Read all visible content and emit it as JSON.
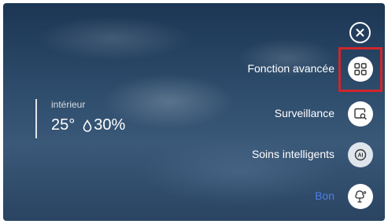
{
  "indoor": {
    "label": "intérieur",
    "temperature": "25°",
    "humidity": "30%"
  },
  "menu": {
    "items": [
      {
        "label": "Fonction avancée",
        "icon": "grid-icon",
        "highlighted": true
      },
      {
        "label": "Surveillance",
        "icon": "monitor-search-icon"
      },
      {
        "label": "Soins intelligents",
        "icon": "ai-care-icon"
      },
      {
        "label": "Bon",
        "icon": "tree-icon",
        "color": "#4b7fe8"
      }
    ]
  },
  "colors": {
    "highlight_border": "#d0262b",
    "status_blue": "#4b7fe8"
  }
}
